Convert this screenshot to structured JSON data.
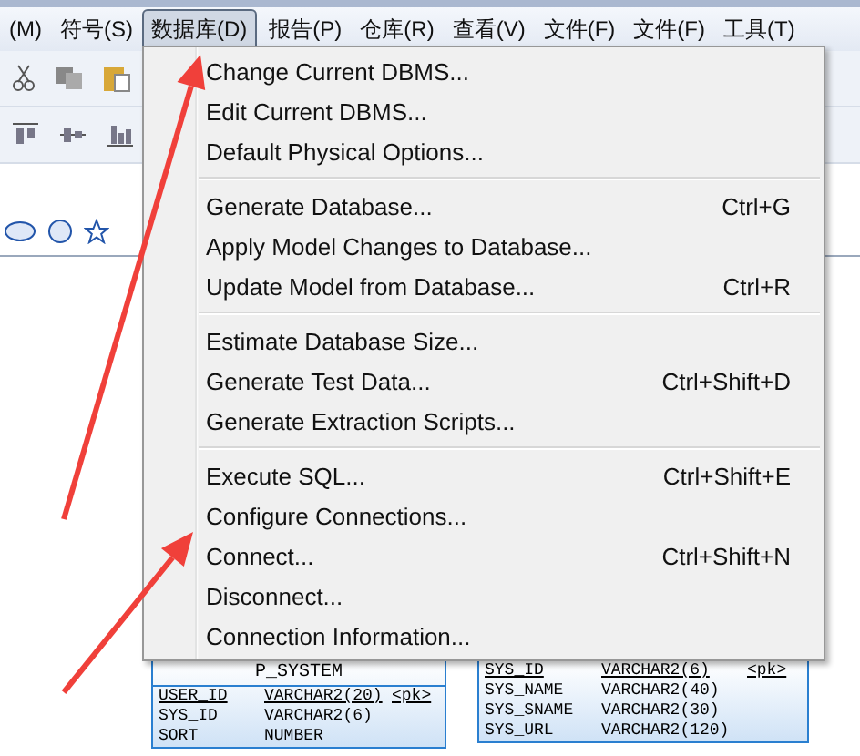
{
  "menubar": [
    {
      "label": "(M)",
      "selected": false
    },
    {
      "label": "符号(S)",
      "selected": false
    },
    {
      "label": "数据库(D)",
      "selected": true
    },
    {
      "label": "报告(P)",
      "selected": false
    },
    {
      "label": "仓库(R)",
      "selected": false
    },
    {
      "label": "查看(V)",
      "selected": false
    },
    {
      "label": "文件(F)",
      "selected": false
    },
    {
      "label": "文件(F)",
      "selected": false
    },
    {
      "label": "工具(T)",
      "selected": false
    }
  ],
  "menu": {
    "groups": [
      [
        {
          "label": "Change Current DBMS..."
        },
        {
          "label": "Edit Current DBMS..."
        },
        {
          "label": "Default Physical Options..."
        }
      ],
      [
        {
          "label": "Generate Database...",
          "shortcut": "Ctrl+G"
        },
        {
          "label": "Apply Model Changes to Database..."
        },
        {
          "label": "Update Model from Database...",
          "shortcut": "Ctrl+R"
        }
      ],
      [
        {
          "label": "Estimate Database Size..."
        },
        {
          "label": "Generate Test Data...",
          "shortcut": "Ctrl+Shift+D"
        },
        {
          "label": "Generate Extraction Scripts..."
        }
      ],
      [
        {
          "label": "Execute SQL...",
          "shortcut": "Ctrl+Shift+E"
        },
        {
          "label": "Configure Connections..."
        },
        {
          "label": "Connect...",
          "shortcut": "Ctrl+Shift+N"
        },
        {
          "label": "Disconnect..."
        },
        {
          "label": "Connection Information..."
        }
      ]
    ]
  },
  "tables": [
    {
      "title": "P_SYSTEM",
      "rows": [
        {
          "name": "USER_ID",
          "type": "VARCHAR2(20)",
          "key": "<pk>"
        },
        {
          "name": "SYS_ID",
          "type": "VARCHAR2(6)"
        },
        {
          "name": "SORT",
          "type": "NUMBER"
        }
      ]
    },
    {
      "rows": [
        {
          "name": "SYS_ID",
          "type": "VARCHAR2(6)",
          "key": "<pk>"
        },
        {
          "name": "SYS_NAME",
          "type": "VARCHAR2(40)"
        },
        {
          "name": "SYS_SNAME",
          "type": "VARCHAR2(30)"
        },
        {
          "name": "SYS_URL",
          "type": "VARCHAR2(120)"
        }
      ]
    }
  ]
}
